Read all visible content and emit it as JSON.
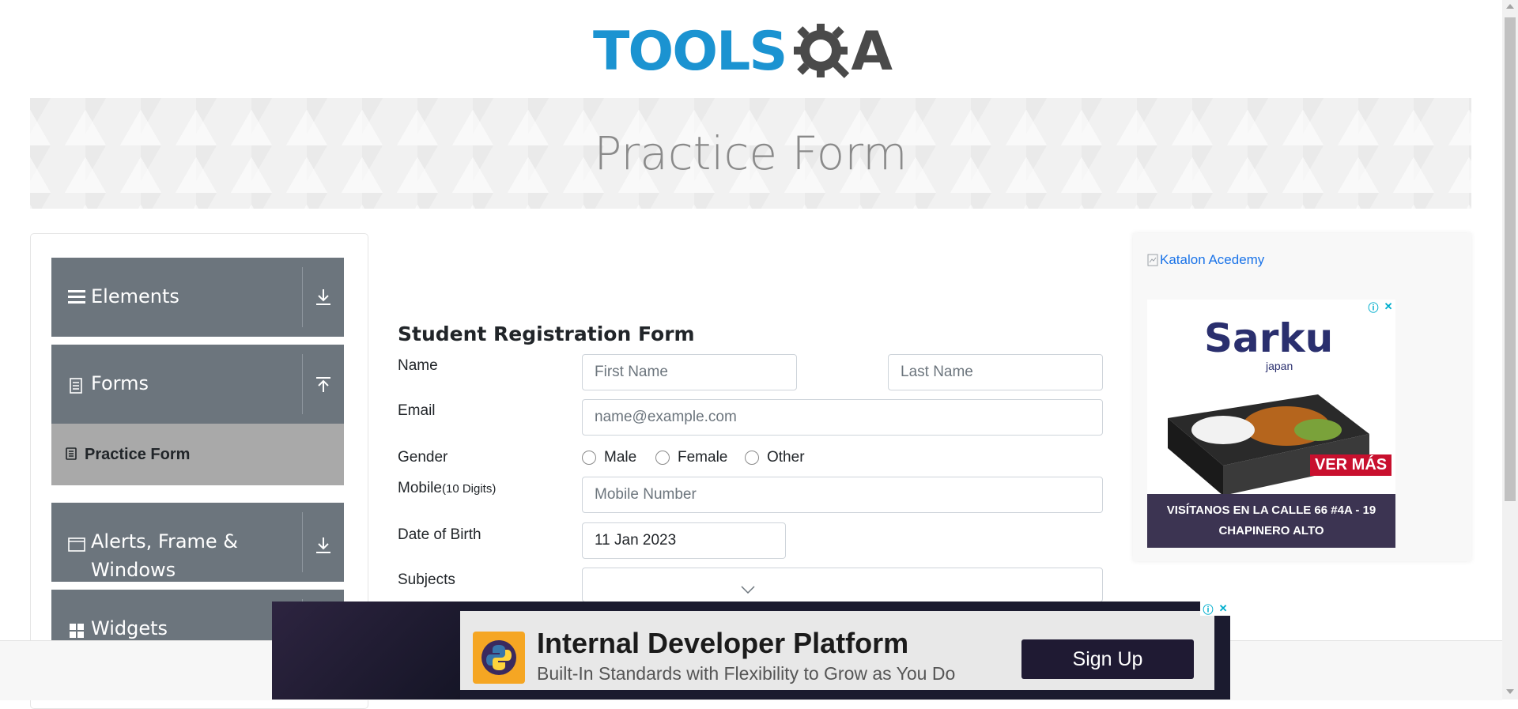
{
  "logo": {
    "text_left": "TOOLS",
    "text_right": "A",
    "alt": "TOOLSQA"
  },
  "banner": {
    "title": "Practice Form"
  },
  "sidebar": {
    "groups": [
      {
        "label": "Elements",
        "icon": "menu-icon",
        "state": "collapsed"
      },
      {
        "label": "Forms",
        "icon": "document-icon",
        "state": "expanded"
      },
      {
        "label": "Alerts, Frame &",
        "label2": "Windows",
        "icon": "window-icon",
        "state": "collapsed"
      },
      {
        "label": "Widgets",
        "icon": "widgets-icon",
        "state": "collapsed"
      }
    ],
    "subitems": [
      {
        "label": "Practice Form",
        "icon": "form-icon",
        "active": true
      }
    ]
  },
  "form": {
    "title": "Student Registration Form",
    "name_label": "Name",
    "first_name_placeholder": "First Name",
    "last_name_placeholder": "Last Name",
    "email_label": "Email",
    "email_placeholder": "name@example.com",
    "gender_label": "Gender",
    "gender_options": [
      "Male",
      "Female",
      "Other"
    ],
    "mobile_label": "Mobile",
    "mobile_hint": "(10 Digits)",
    "mobile_placeholder": "Mobile Number",
    "dob_label": "Date of Birth",
    "dob_value": "11 Jan 2023",
    "subjects_label": "Subjects"
  },
  "ads": {
    "katalon_alt": "Katalon Acedemy",
    "sarku": {
      "brand": "Sarku",
      "brand_sub": "japan",
      "cta": "VER MÁS",
      "line1": "VISÍTANOS EN LA CALLE 66 #4A - 19",
      "line2": "CHAPINERO ALTO"
    },
    "bottom": {
      "title": "Internal Developer Platform",
      "subtitle": "Built-In Standards with Flexibility to Grow as You Do",
      "button": "Sign Up"
    }
  },
  "colors": {
    "accent": "#1b93d1",
    "sidebar_bg": "#6c757d",
    "active_bg": "#a9a9a9"
  }
}
